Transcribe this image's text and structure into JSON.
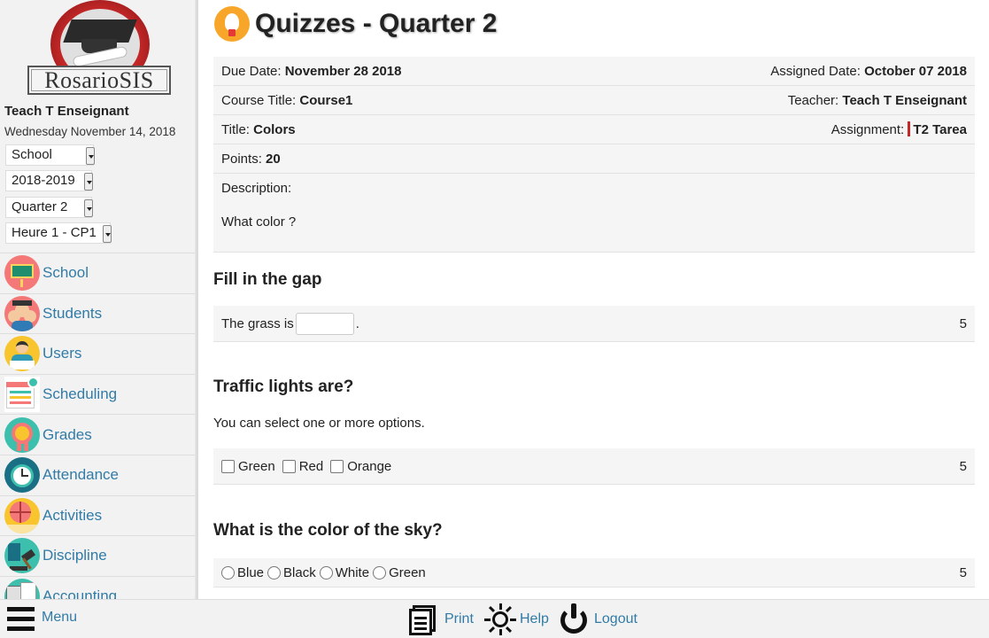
{
  "sidebar": {
    "logo_text": "RosarioSIS",
    "user_name": "Teach T Enseignant",
    "date": "Wednesday November 14, 2018",
    "selects": {
      "school": "School",
      "year": "2018-2019",
      "quarter": "Quarter 2",
      "period": "Heure 1 - CP1"
    },
    "menu": [
      {
        "label": "School",
        "icon": "school-icon",
        "color": "#f47878"
      },
      {
        "label": "Students",
        "icon": "students-icon",
        "color": "#f47878"
      },
      {
        "label": "Users",
        "icon": "users-icon",
        "color": "#f8c52e"
      },
      {
        "label": "Scheduling",
        "icon": "scheduling-icon",
        "color": "#ffffff"
      },
      {
        "label": "Grades",
        "icon": "grades-icon",
        "color": "#3dbfae"
      },
      {
        "label": "Attendance",
        "icon": "attendance-icon",
        "color": "#1b6f84"
      },
      {
        "label": "Activities",
        "icon": "activities-icon",
        "color": "#f8c52e"
      },
      {
        "label": "Discipline",
        "icon": "discipline-icon",
        "color": "#3dbfae"
      },
      {
        "label": "Accounting",
        "icon": "accounting-icon",
        "color": "#3dbfae"
      }
    ]
  },
  "main": {
    "title": "Quizzes - Quarter 2",
    "info": {
      "due_label": "Due Date:",
      "due_value": "November 28 2018",
      "assigned_label": "Assigned Date:",
      "assigned_value": "October 07 2018",
      "course_label": "Course Title:",
      "course_value": "Course1",
      "teacher_label": "Teacher:",
      "teacher_value": "Teach T Enseignant",
      "title_label": "Title:",
      "title_value": "Colors",
      "assignment_label": "Assignment:",
      "assignment_value": "T2 Tarea",
      "points_label": "Points:",
      "points_value": "20",
      "description_label": "Description:",
      "description_value": "What color ?"
    },
    "questions": [
      {
        "title": "Fill in the gap",
        "text_before": "The grass is",
        "text_after": ".",
        "points": "5"
      },
      {
        "title": "Traffic lights are?",
        "help": "You can select one or more options.",
        "options": [
          "Green",
          "Red",
          "Orange"
        ],
        "points": "5"
      },
      {
        "title": "What is the color of the sky?",
        "options": [
          "Blue",
          "Black",
          "White",
          "Green"
        ],
        "points": "5"
      }
    ]
  },
  "footer": {
    "menu_label": "Menu",
    "print_label": "Print",
    "help_label": "Help",
    "logout_label": "Logout"
  }
}
